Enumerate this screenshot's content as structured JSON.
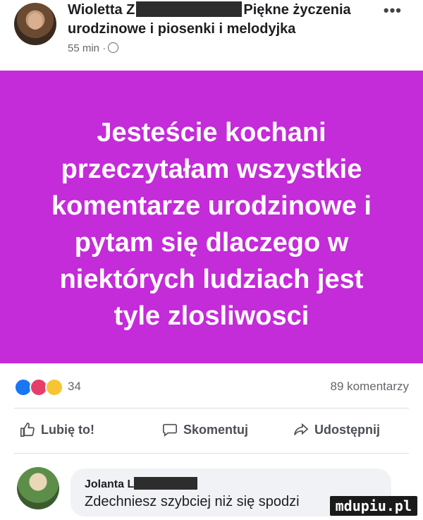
{
  "post": {
    "author_first": "Wioletta Z",
    "title_suffix": "Piękne życzenia",
    "subtitle": "urodzinowe i piosenki i melodyjka",
    "time": "55 min ·",
    "more": "•••",
    "body_lines": [
      "Jesteście kochani",
      "przeczytałam wszystkie",
      "komentarze urodzinowe i",
      "pytam się dlaczego w",
      "niektórych ludziach jest",
      "tyle zlosliwosci"
    ],
    "body_bg": "#c42bd9"
  },
  "reactions": {
    "count": "34",
    "comments": "89 komentarzy"
  },
  "actions": {
    "like": "Lubię to!",
    "comment": "Skomentuj",
    "share": "Udostępnij"
  },
  "comment": {
    "author": "Jolanta L",
    "text": "Zdechniesz szybciej niż się spodzi"
  },
  "watermark": "mdupiu.pl"
}
